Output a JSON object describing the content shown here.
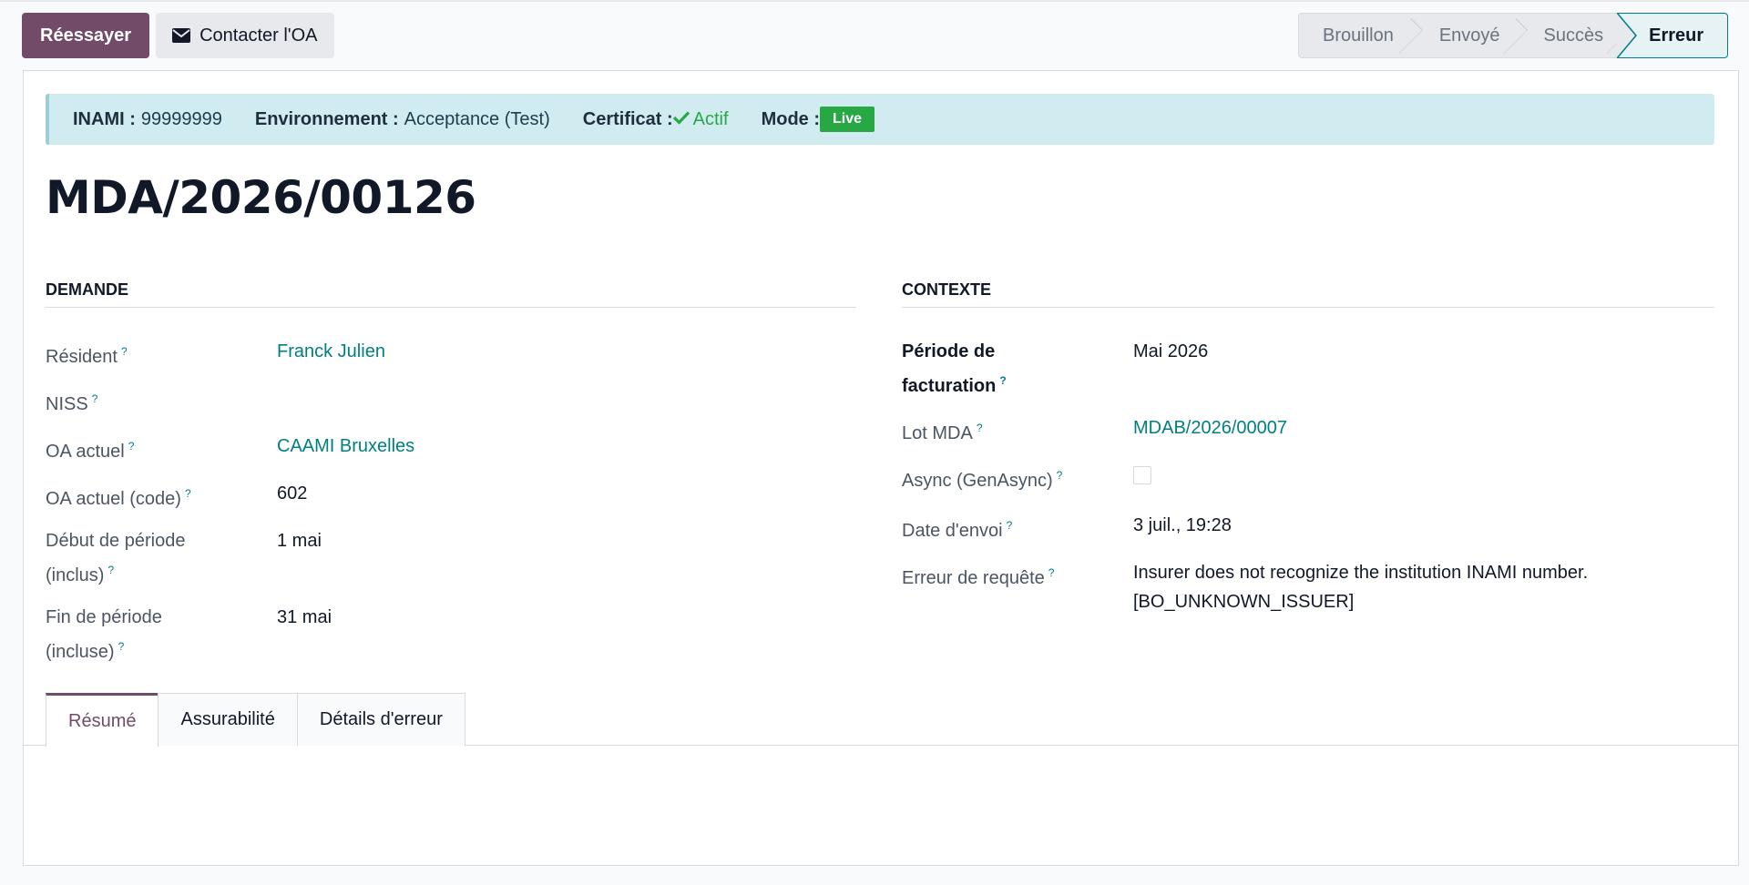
{
  "control_panel": {
    "retry_label": "Réessayer",
    "contact_label": "Contacter l'OA"
  },
  "statusbar": {
    "stages": [
      "Brouillon",
      "Envoyé",
      "Succès",
      "Erreur"
    ],
    "active": "Erreur"
  },
  "alert": {
    "inami_label": "INAMI :",
    "inami_value": "99999999",
    "env_label": "Environnement :",
    "env_value": "Acceptance (Test)",
    "cert_label": "Certificat :",
    "cert_value": "Actif",
    "mode_label": "Mode :",
    "mode_value": "Live"
  },
  "record": {
    "name": "MDA/2026/00126"
  },
  "demande": {
    "title": "DEMANDE",
    "fields": [
      {
        "label": "Résident",
        "value": "Franck Julien",
        "link": true
      },
      {
        "label": "NISS",
        "value": ""
      },
      {
        "label": "OA actuel",
        "value": "CAAMI Bruxelles",
        "link": true
      },
      {
        "label": "OA actuel (code)",
        "value": "602"
      },
      {
        "label": "Début de période",
        "label2": "(inclus)",
        "value": "1 mai"
      },
      {
        "label": "Fin de période",
        "label2": "(incluse)",
        "value": "31 mai"
      }
    ]
  },
  "contexte": {
    "title": "CONTEXTE",
    "fields": [
      {
        "label": "Période de",
        "label2": "facturation",
        "value": "Mai 2026"
      },
      {
        "label": "Lot MDA",
        "value": "MDAB/2026/00007",
        "link": true
      },
      {
        "label": "Async (GenAsync)",
        "value": ""
      },
      {
        "label": "Date d'envoi",
        "value": "3 juil., 19:28"
      },
      {
        "label": "Erreur de requête",
        "value": "Insurer does not recognize the institution INAMI number.",
        "value2": "[BO_UNKNOWN_ISSUER]"
      }
    ]
  },
  "tabs": [
    "Résumé",
    "Assurabilité",
    "Détails d'erreur"
  ],
  "help_mark": "?",
  "icons": {
    "envelope": "envelope-icon",
    "check": "check-icon"
  },
  "colors": {
    "primary": "#714b67",
    "link": "#017e84",
    "success": "#28a745",
    "alert_bg": "#d1ecf1"
  }
}
